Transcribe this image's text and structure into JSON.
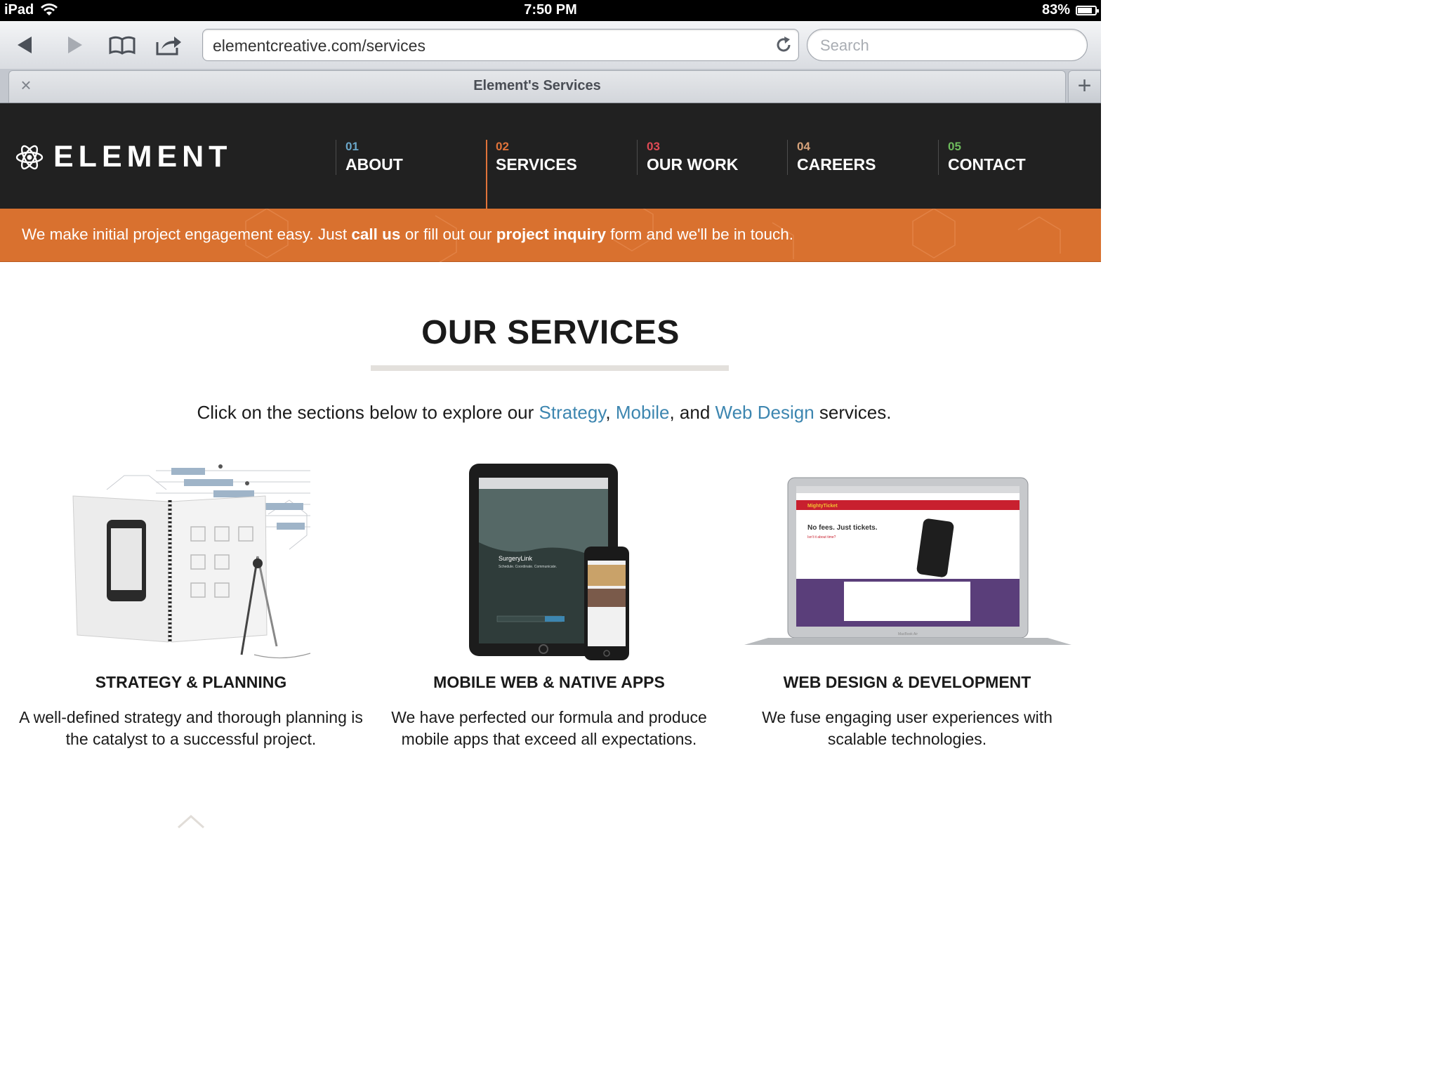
{
  "status_bar": {
    "device": "iPad",
    "time": "7:50 PM",
    "battery": "83%",
    "battery_level": 0.83
  },
  "browser": {
    "url": "elementcreative.com/services",
    "search_placeholder": "Search",
    "tab_title": "Element's Services",
    "new_tab_label": "+",
    "close_tab_label": "×"
  },
  "site": {
    "logo": "ELEMENT",
    "nav": [
      {
        "num": "01",
        "label": "ABOUT",
        "color": "#6aa6c8"
      },
      {
        "num": "02",
        "label": "SERVICES",
        "color": "#e0733a"
      },
      {
        "num": "03",
        "label": "OUR WORK",
        "color": "#e04a55"
      },
      {
        "num": "04",
        "label": "CAREERS",
        "color": "#d6a27a"
      },
      {
        "num": "05",
        "label": "CONTACT",
        "color": "#6dbb5c"
      }
    ],
    "banner": {
      "text1": "We make initial project engagement easy. Just ",
      "link1": "call us",
      "text2": " or fill out our ",
      "link2": "project inquiry",
      "text3": " form and we'll be in touch.",
      "color": "#d9712f"
    },
    "title": "OUR SERVICES",
    "intro": {
      "prefix": "Click on the sections below to explore our ",
      "link1": "Strategy",
      "sep1": ", ",
      "link2": "Mobile",
      "sep2": ", and ",
      "link3": "Web Design",
      "suffix": " services."
    },
    "services": [
      {
        "title": "STRATEGY & PLANNING",
        "desc": "A well-defined strategy and thorough planning is the catalyst to a successful project."
      },
      {
        "title": "MOBILE WEB & NATIVE APPS",
        "desc": "We have perfected our formula and produce mobile apps that exceed all expectations.",
        "art": {
          "app_name": "SurgeryLink",
          "tagline": "Schedule. Coordinate. Communicate.",
          "email_label": "Your email"
        }
      },
      {
        "title": "WEB DESIGN & DEVELOPMENT",
        "desc": "We fuse engaging user experiences with scalable technologies.",
        "art": {
          "brand": "MightyTicket",
          "headline": "No fees. Just tickets.",
          "subhead": "Isn't it about time?",
          "laptop_label": "MacBook Air"
        }
      }
    ]
  }
}
